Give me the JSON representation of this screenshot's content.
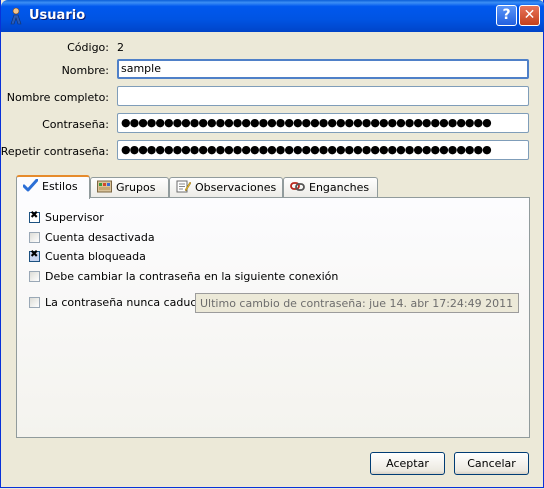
{
  "window": {
    "title": "Usuario",
    "help_glyph": "?",
    "close_glyph": "✕"
  },
  "form": {
    "codigo_label": "Código:",
    "codigo_value": "2",
    "nombre_label": "Nombre:",
    "nombre_value": "sample",
    "nombre_completo_label": "Nombre completo:",
    "nombre_completo_value": "",
    "contrasena_label": "Contraseña:",
    "contrasena_value": "●●●●●●●●●●●●●●●●●●●●●●●●●●●●●●●●●●●●●●●●●●●",
    "repetir_label": "Repetir contraseña:",
    "repetir_value": "●●●●●●●●●●●●●●●●●●●●●●●●●●●●●●●●●●●●●●●●●●●"
  },
  "tabs": [
    {
      "label": "Estilos",
      "icon": "checkmark-icon",
      "active": true
    },
    {
      "label": "Grupos",
      "icon": "groups-icon",
      "active": false
    },
    {
      "label": "Observaciones",
      "icon": "notes-icon",
      "active": false
    },
    {
      "label": "Enganches",
      "icon": "chain-links-icon",
      "active": false
    }
  ],
  "estilos": {
    "supervisor": {
      "label": "Supervisor",
      "checked": true
    },
    "cuenta_desactivada": {
      "label": "Cuenta desactivada",
      "checked": false
    },
    "cuenta_bloqueada": {
      "label": "Cuenta bloqueada",
      "checked": true
    },
    "debe_cambiar": {
      "label": "Debe cambiar la contraseña en la siguiente conexión",
      "checked": false
    },
    "nunca_caduca": {
      "label": "La contraseña nunca caduca",
      "checked": false
    },
    "ultimo_cambio": "Ultimo cambio de contraseña: jue 14. abr 17:24:49 2011"
  },
  "buttons": {
    "aceptar": "Aceptar",
    "cancelar": "Cancelar"
  },
  "colors": {
    "title_bar": "#0054e3",
    "tab_active_accent": "#e68b2c",
    "dialog_bg": "#ece9d8"
  }
}
